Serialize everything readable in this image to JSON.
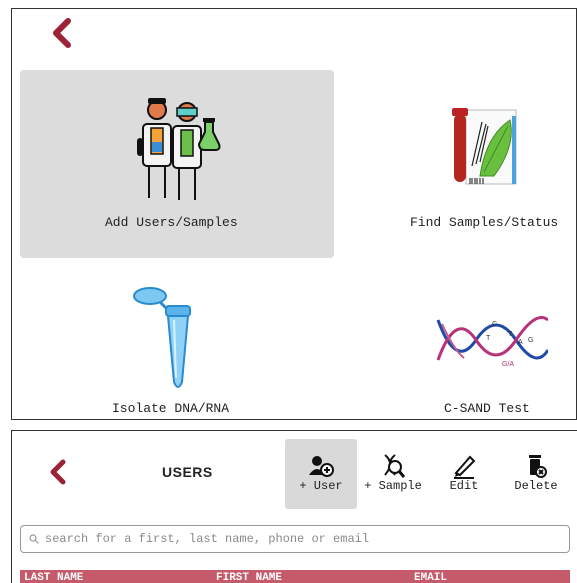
{
  "colors": {
    "accent": "#9b2335",
    "tile_active_bg": "#dcdcdc",
    "table_header_bg": "#c55a6a"
  },
  "top_panel": {
    "back_icon": "chevron-left-icon",
    "tiles": [
      {
        "label": "Add Users/Samples",
        "icon": "scientists-icon",
        "active": true
      },
      {
        "label": "Find Samples/Status",
        "icon": "test-tube-leaf-icon",
        "active": false
      },
      {
        "label": "Isolate DNA/RNA",
        "icon": "microtube-icon",
        "active": false
      },
      {
        "label": "C-SAND Test",
        "icon": "dna-helix-icon",
        "active": false
      }
    ],
    "dna_letters": [
      "C",
      "T",
      "T",
      "A",
      "G",
      "G/A"
    ]
  },
  "users_panel": {
    "title": "USERS",
    "toolbar": {
      "add_user": "+ User",
      "add_sample": "+ Sample",
      "edit": "Edit",
      "delete": "Delete"
    },
    "search": {
      "placeholder": "search for a first, last name, phone or email"
    },
    "table": {
      "columns": [
        "LAST NAME",
        "FIRST NAME",
        "EMAIL"
      ]
    }
  }
}
